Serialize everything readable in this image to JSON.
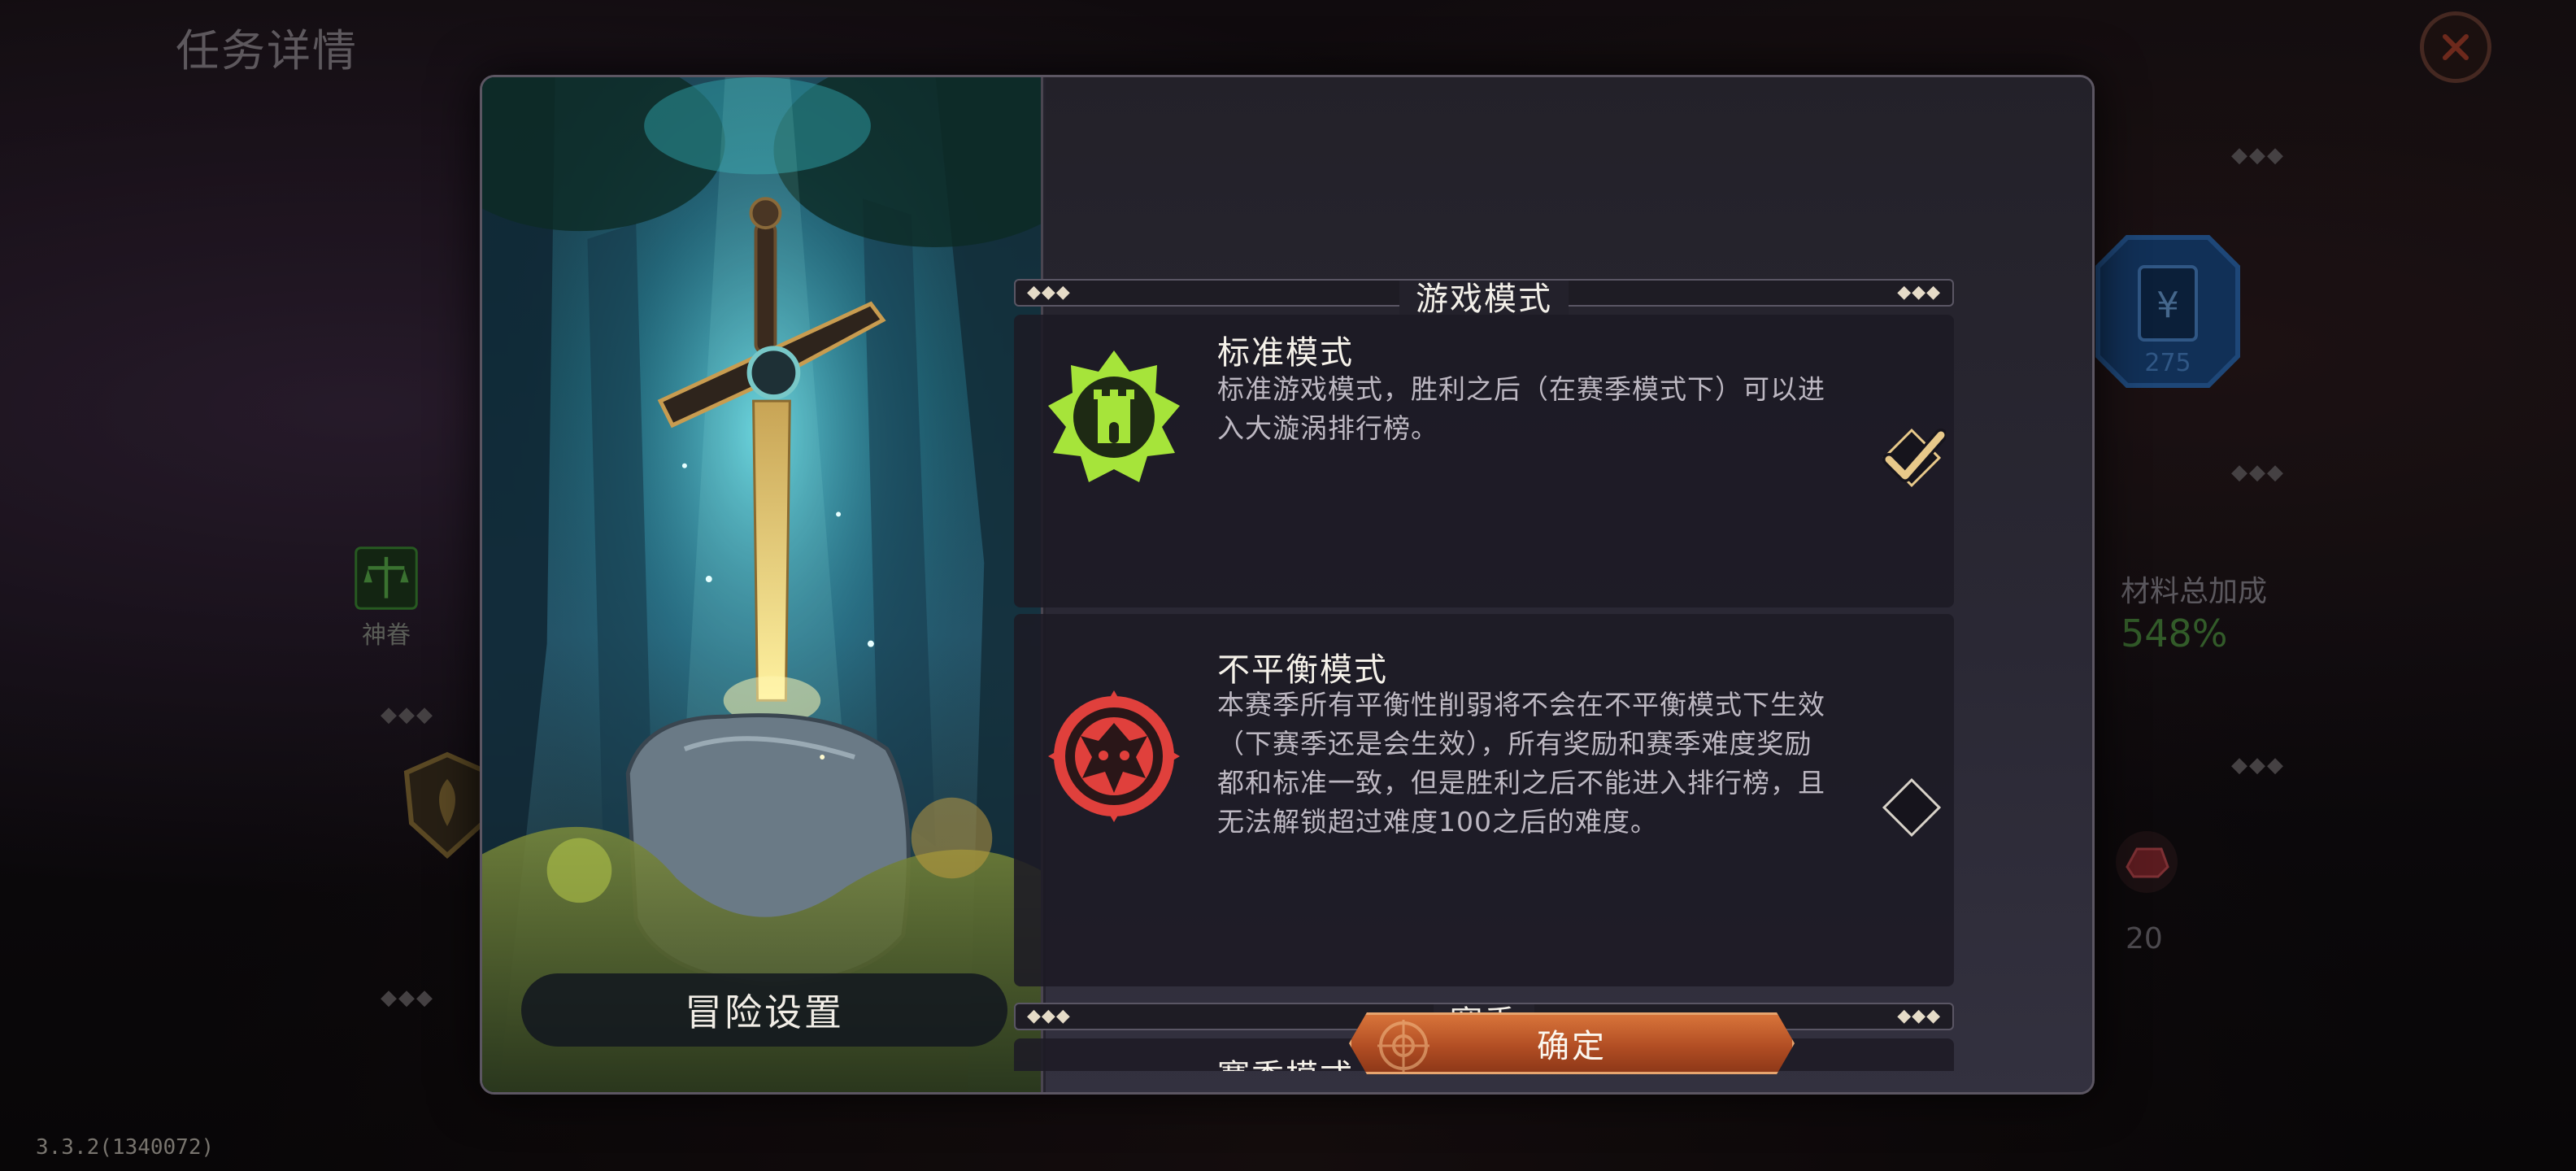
{
  "background": {
    "title": "任务详情",
    "version": "3.3.2(1340072)",
    "badge_label": "神眷",
    "stat_label": "材料总加成",
    "stat_value": "548%",
    "ingot_count": "20",
    "card_value": "275"
  },
  "modal": {
    "art_caption": "冒险设置",
    "sections": {
      "game_mode": {
        "title": "游戏模式"
      },
      "season": {
        "title": "赛季"
      }
    },
    "modes": [
      {
        "name": "标准模式",
        "description": "标准游戏模式，胜利之后（在赛季模式下）可以进入大漩涡排行榜。",
        "selected": true,
        "icon": "tower-emblem-icon",
        "color": "#a6e43a"
      },
      {
        "name": "不平衡模式",
        "description": "本赛季所有平衡性削弱将不会在不平衡模式下生效（下赛季还是会生效），所有奖励和赛季难度奖励都和标准一致，但是胜利之后不能进入排行榜，且无法解锁超过难度100之后的难度。",
        "selected": false,
        "icon": "demon-emblem-icon",
        "color": "#e0403c"
      }
    ],
    "season_mode": {
      "name": "赛季模式"
    },
    "confirm_label": "确定"
  },
  "colors": {
    "accent_orange": "#c75a2a",
    "check_gold": "#e8c98a"
  }
}
